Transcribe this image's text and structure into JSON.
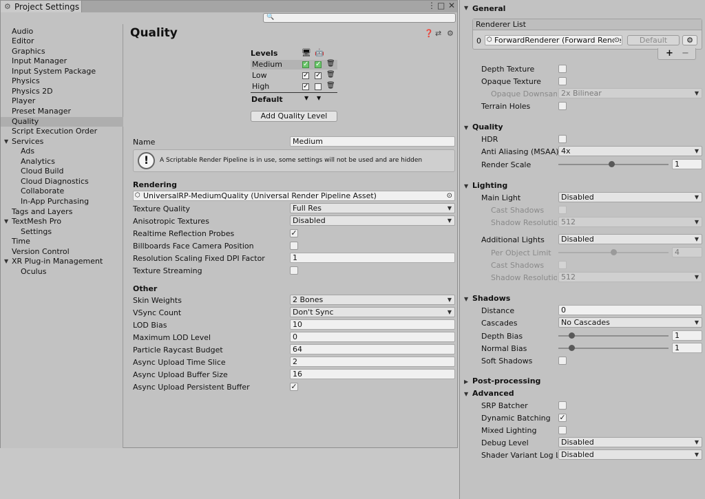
{
  "window": {
    "tab_title": "Project Settings",
    "search_placeholder": "",
    "page_title": "Quality"
  },
  "sidebar": [
    {
      "label": "Audio"
    },
    {
      "label": "Editor"
    },
    {
      "label": "Graphics"
    },
    {
      "label": "Input Manager"
    },
    {
      "label": "Input System Package"
    },
    {
      "label": "Physics"
    },
    {
      "label": "Physics 2D"
    },
    {
      "label": "Player"
    },
    {
      "label": "Preset Manager"
    },
    {
      "label": "Quality"
    },
    {
      "label": "Script Execution Order"
    },
    {
      "label": "Services"
    },
    {
      "label": "Ads"
    },
    {
      "label": "Analytics"
    },
    {
      "label": "Cloud Build"
    },
    {
      "label": "Cloud Diagnostics"
    },
    {
      "label": "Collaborate"
    },
    {
      "label": "In-App Purchasing"
    },
    {
      "label": "Tags and Layers"
    },
    {
      "label": "TextMesh Pro"
    },
    {
      "label": "Settings"
    },
    {
      "label": "Time"
    },
    {
      "label": "Version Control"
    },
    {
      "label": "XR Plug-in Management"
    },
    {
      "label": "Oculus"
    }
  ],
  "levels": {
    "heading": "Levels",
    "rows": [
      "Medium",
      "Low",
      "High"
    ],
    "default_label": "Default",
    "add_button": "Add Quality Level"
  },
  "quality": {
    "name_label": "Name",
    "name_value": "Medium",
    "help_text": "A Scriptable Render Pipeline is in use, some settings will not be used and are hidden",
    "rendering_heading": "Rendering",
    "pipeline_asset": "UniversalRP-MediumQuality (Universal Render Pipeline Asset)",
    "texture_quality_label": "Texture Quality",
    "texture_quality_value": "Full Res",
    "anisotropic_label": "Anisotropic Textures",
    "anisotropic_value": "Disabled",
    "realtime_reflection_label": "Realtime Reflection Probes",
    "billboards_label": "Billboards Face Camera Position",
    "res_scaling_label": "Resolution Scaling Fixed DPI Factor",
    "res_scaling_value": "1",
    "texture_streaming_label": "Texture Streaming",
    "other_heading": "Other",
    "skin_weights_label": "Skin Weights",
    "skin_weights_value": "2 Bones",
    "vsync_label": "VSync Count",
    "vsync_value": "Don't Sync",
    "lod_bias_label": "LOD Bias",
    "lod_bias_value": "10",
    "max_lod_label": "Maximum LOD Level",
    "max_lod_value": "0",
    "particle_raycast_label": "Particle Raycast Budget",
    "particle_raycast_value": "64",
    "async_time_label": "Async Upload Time Slice",
    "async_time_value": "2",
    "async_buffer_label": "Async Upload Buffer Size",
    "async_buffer_value": "16",
    "async_persistent_label": "Async Upload Persistent Buffer"
  },
  "inspector": {
    "general_heading": "General",
    "renderer_list_heading": "Renderer List",
    "renderer_index": "0",
    "renderer_value": "ForwardRenderer (Forward Rende",
    "renderer_default_btn": "Default",
    "plus": "+",
    "minus": "−",
    "depth_texture": "Depth Texture",
    "opaque_texture": "Opaque Texture",
    "opaque_downsampling": "Opaque Downsamp",
    "opaque_downsampling_value": "2x Bilinear",
    "terrain_holes": "Terrain Holes",
    "quality_heading": "Quality",
    "hdr": "HDR",
    "anti_aliasing": "Anti Aliasing (MSAA)",
    "anti_aliasing_value": "4x",
    "render_scale": "Render Scale",
    "render_scale_value": "1",
    "lighting_heading": "Lighting",
    "main_light": "Main Light",
    "main_light_value": "Disabled",
    "cast_shadows_1": "Cast Shadows",
    "shadow_res_1": "Shadow Resolutio",
    "shadow_res_1_value": "512",
    "additional_lights": "Additional Lights",
    "additional_lights_value": "Disabled",
    "per_object_limit": "Per Object Limit",
    "per_object_limit_value": "4",
    "cast_shadows_2": "Cast Shadows",
    "shadow_res_2": "Shadow Resolutio",
    "shadow_res_2_value": "512",
    "shadows_heading": "Shadows",
    "distance": "Distance",
    "distance_value": "0",
    "cascades": "Cascades",
    "cascades_value": "No Cascades",
    "depth_bias": "Depth Bias",
    "depth_bias_value": "1",
    "normal_bias": "Normal Bias",
    "normal_bias_value": "1",
    "soft_shadows": "Soft Shadows",
    "post_processing_heading": "Post-processing",
    "advanced_heading": "Advanced",
    "srp_batcher": "SRP Batcher",
    "dynamic_batching": "Dynamic Batching",
    "mixed_lighting": "Mixed Lighting",
    "debug_level": "Debug Level",
    "debug_level_value": "Disabled",
    "shader_variant_log": "Shader Variant Log Le",
    "shader_variant_log_value": "Disabled"
  },
  "sliders": {
    "render_scale": 0.48,
    "per_object_limit": 0.5,
    "depth_bias": 0.12,
    "normal_bias": 0.12
  },
  "icons": {
    "search": "search-icon",
    "help": "help-icon",
    "presets": "presets-icon",
    "gear": "gear-icon",
    "warning": "warning-icon",
    "trash": "trash-icon",
    "monitor": "monitor-icon",
    "android": "android-icon",
    "object_picker": "object-picker-icon"
  }
}
